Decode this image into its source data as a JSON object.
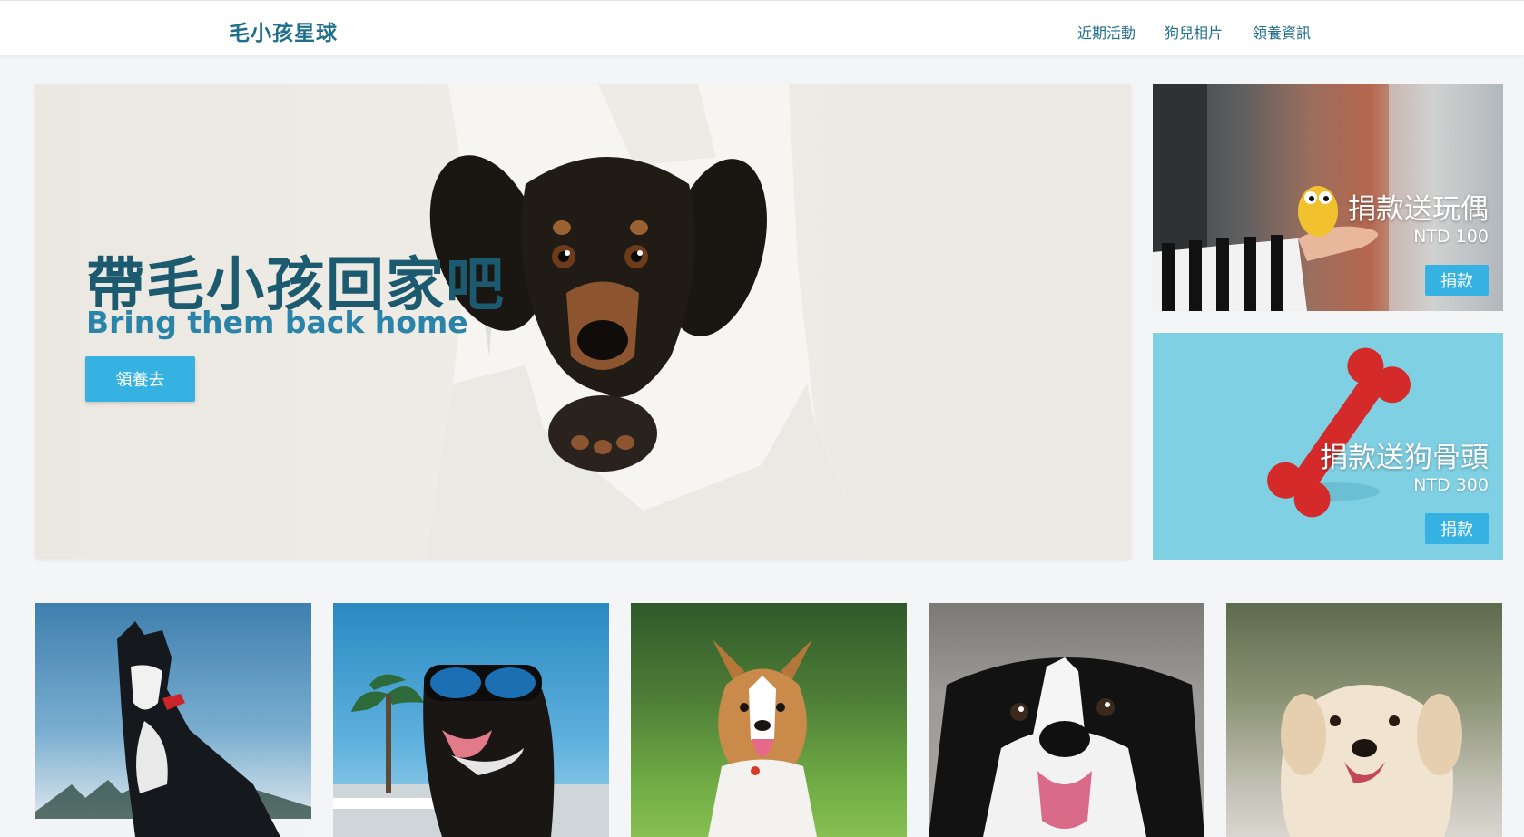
{
  "navbar": {
    "brand": "毛小孩星球",
    "links": [
      "近期活動",
      "狗兒相片",
      "領養資訊"
    ]
  },
  "hero": {
    "title": "帶毛小孩回家吧",
    "subtitle": "Bring them back home",
    "button_label": "領養去"
  },
  "promos": [
    {
      "title": "捐款送玩偶",
      "price": "NTD 100",
      "button_label": "捐款"
    },
    {
      "title": "捐款送狗骨頭",
      "price": "NTD 300",
      "button_label": "捐款"
    }
  ],
  "gallery": [
    {
      "name": "border-collie-snow-photo"
    },
    {
      "name": "dog-sunglasses-photo"
    },
    {
      "name": "corgi-grass-photo"
    },
    {
      "name": "collie-closeup-photo"
    },
    {
      "name": "golden-retriever-photo"
    }
  ],
  "colors": {
    "brand": "#1f6f8b",
    "accent": "#35b1e2",
    "hero_title": "#1c5a70",
    "page_bg": "#f4f5f7"
  }
}
